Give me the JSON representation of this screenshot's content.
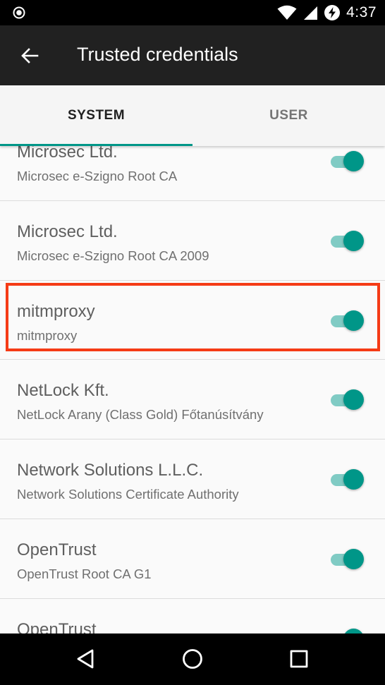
{
  "status_bar": {
    "left_icon": "radio-button-icon",
    "icons": [
      "wifi-icon",
      "cellular-signal-icon",
      "battery-charging-icon"
    ],
    "time": "4:37"
  },
  "app_bar": {
    "back_icon": "arrow-back-icon",
    "title": "Trusted credentials"
  },
  "tabs": [
    {
      "label": "SYSTEM",
      "selected": true
    },
    {
      "label": "USER",
      "selected": false
    }
  ],
  "accent_color": "#009688",
  "highlight_color": "#f53b16",
  "credentials": [
    {
      "title": "Microsec Ltd.",
      "subtitle": "Microsec e-Szigno Root CA",
      "enabled": true
    },
    {
      "title": "Microsec Ltd.",
      "subtitle": "Microsec e-Szigno Root CA 2009",
      "enabled": true
    },
    {
      "title": "mitmproxy",
      "subtitle": "mitmproxy",
      "enabled": true,
      "highlighted": true
    },
    {
      "title": "NetLock Kft.",
      "subtitle": "NetLock Arany (Class Gold) Főtanúsítvány",
      "enabled": true
    },
    {
      "title": "Network Solutions L.L.C.",
      "subtitle": "Network Solutions Certificate Authority",
      "enabled": true
    },
    {
      "title": "OpenTrust",
      "subtitle": "OpenTrust Root CA G1",
      "enabled": true
    },
    {
      "title": "OpenTrust",
      "subtitle": "",
      "enabled": true
    }
  ],
  "nav_bar": [
    "back-triangle-icon",
    "home-circle-icon",
    "recents-square-icon"
  ]
}
